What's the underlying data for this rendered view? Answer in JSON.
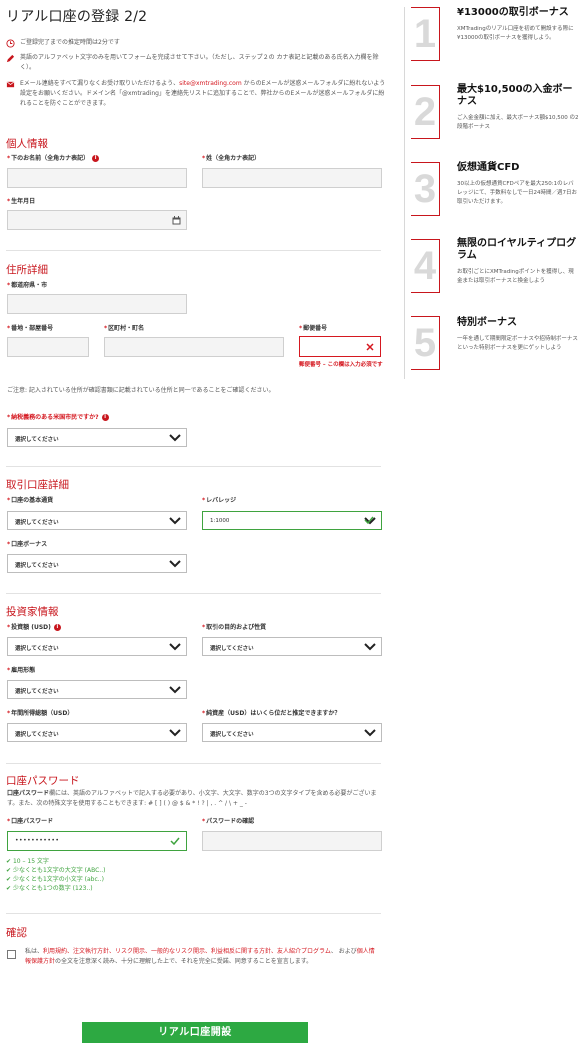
{
  "page": {
    "title": "リアル口座の登録 2/2",
    "time_notice": "ご登録完了までの推定時間は2分です",
    "alphabet_notice": "英語のアルファベット文字のみを用いてフォームを完成させて下さい。（ただし、ステップ２の カナ表記と記載のある氏名入力欄を除く）。",
    "email_notice_prefix": "Eメール連絡をすべて漏りなくお受け取りいただけるよう、",
    "email_address": "site@xmtrading.com",
    "email_notice_suffix": " からのEメールが迷惑メールフォルダに紛れないよう設定をお願いください。ドメイン名「@xmtrading」を連絡先リストに追加することで、弊社からのEメールが迷惑メールフォルダに紛れることを防ぐことができます。"
  },
  "personal": {
    "title": "個人情報",
    "first_name_label": "下のお名前（全角カナ表記）",
    "last_name_label": "姓（全角カナ表記）",
    "dob_label": "生年月日"
  },
  "address": {
    "title": "住所詳細",
    "prefecture_label": "都道府県・市",
    "street_label": "番地・部屋番号",
    "district_label": "区町村・町名",
    "postal_label": "郵便番号",
    "postal_error": "郵便番号 – この欄は入力必須です",
    "address_note": "ご注意: 記入されている住所が確認書類に記載されている住所と同一であることをご確認ください。",
    "us_tax_label": "納税義務のある米国市民ですか?",
    "us_tax_value": "選択してください"
  },
  "account": {
    "title": "取引口座詳細",
    "base_currency_label": "口座の基本通貨",
    "base_currency_value": "選択してください",
    "leverage_label": "レバレッジ",
    "leverage_value": "1:1000",
    "bonus_label": "口座ボーナス",
    "bonus_value": "選択してください"
  },
  "investor": {
    "title": "投資家情報",
    "investment_label": "投資額 (USD)",
    "investment_value": "選択してください",
    "purpose_label": "取引の目的および性質",
    "purpose_value": "選択してください",
    "employment_label": "雇用形態",
    "employment_value": "選択してください",
    "income_label": "年間所得総額（USD）",
    "income_value": "選択してください",
    "networth_label": "純資産（USD）はいくら位だと推定できますか？",
    "networth_value": "選択してください"
  },
  "password": {
    "title": "口座パスワード",
    "rule_bold": "口座パスワード",
    "rule_text": "欄には、英語のアルファベットで記入する必要があり、小文字、大文字、数字の3つの文字タイプを含める必要がございます。また、次の特殊文字を使用することもできます: # [ ] ( ) @ $ & * ! ? | , . ^ / \\ + _ -",
    "password_label": "口座パスワード",
    "password_value": "•••••••••••",
    "confirm_label": "パスワードの確認",
    "checks": [
      "10 – 15 文字",
      "少なくとも1文字の大文字 (ABC..)",
      "少なくとも1文字の小文字 (abc..)",
      "少なくとも1つの数字 (123..)"
    ]
  },
  "confirm": {
    "title": "確認",
    "consent_prefix": "私は、",
    "consent_links": "利用規約、注文執行方針、リスク開示、一般的なリスク開示、利益相反に関する方針、友人紹介プログラム",
    "consent_middle": "、 および",
    "consent_link2": "個人情報保護方針",
    "consent_suffix": "の全文を注意深く読み、十分に理解した上で、それを完全に受諾、同意することを宣言します。",
    "submit_label": "リアル口座開設"
  },
  "bonuses": [
    {
      "num": "1",
      "title": "¥13000の取引ボーナス",
      "desc": "XMTradingのリアル口座を初めて開設する際に¥13000の取引ボーナスを獲得しよう。"
    },
    {
      "num": "2",
      "title": "最大$10,500の入金ボーナス",
      "desc": "ご入金金額に加え、最大ボーナス額$10,500 の2段階ボーナス"
    },
    {
      "num": "3",
      "title": "仮想通貨CFD",
      "desc": "30以上の仮想通貨CFDペアを最大250:1のレバレッジにて、手数料なしで一日24時間／週7日お取引いただけます。"
    },
    {
      "num": "4",
      "title": "無限のロイヤルティプログラム",
      "desc": "お取引ごとにXMTradingポイントを獲得し、現金または取引ボーナスと換金しよう"
    },
    {
      "num": "5",
      "title": "特別ボーナス",
      "desc": "一年を通して期間限定ボーナスや招待制ボーナスといった特別ボーナスを更にゲットしよう"
    }
  ],
  "colors": {
    "accent": "#c8161d",
    "success": "#2da942"
  },
  "icons": {
    "clock": "clock-icon",
    "pencil": "pencil-icon",
    "mail": "mail-icon",
    "calendar": "calendar-icon",
    "close": "close-icon",
    "chevron": "chevron-down-icon",
    "check": "check-icon"
  }
}
